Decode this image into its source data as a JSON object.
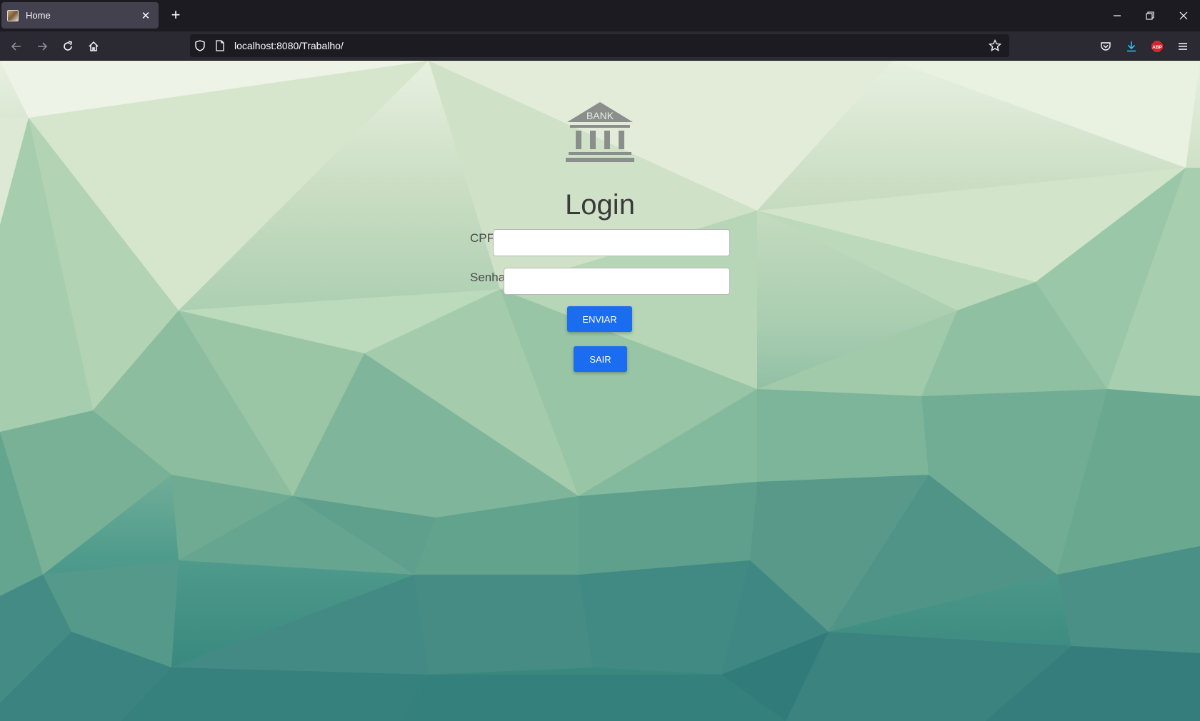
{
  "browser": {
    "tab_title": "Home",
    "tab_close": "✕",
    "new_tab": "+",
    "url": "localhost:8080/Trabalho/",
    "window_controls": [
      "minimize-icon",
      "restore-icon",
      "close-icon"
    ],
    "nav_icons": [
      "back-arrow-icon",
      "forward-arrow-icon",
      "reload-icon",
      "home-icon"
    ],
    "toolbar_icons": [
      "pocket-icon",
      "download-icon",
      "adblock-icon",
      "menu-icon"
    ],
    "adblock_label": "ABP"
  },
  "login": {
    "logo_text": "BANK",
    "heading": "Login",
    "cpf_label": "CPF",
    "cpf_value": "",
    "password_label": "Senha",
    "password_value": "",
    "submit_label": "ENVIAR",
    "exit_label": "SAIR",
    "button_color": "#1a6cf0"
  }
}
